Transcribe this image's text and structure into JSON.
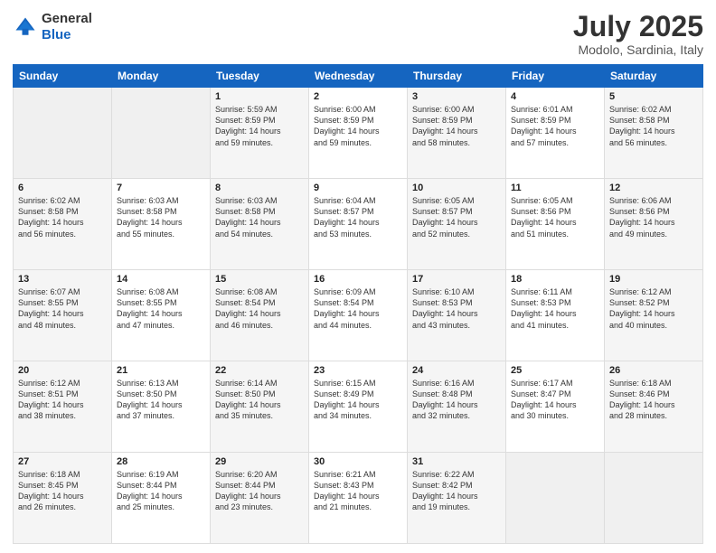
{
  "header": {
    "logo_general": "General",
    "logo_blue": "Blue",
    "title": "July 2025",
    "location": "Modolo, Sardinia, Italy"
  },
  "weekdays": [
    "Sunday",
    "Monday",
    "Tuesday",
    "Wednesday",
    "Thursday",
    "Friday",
    "Saturday"
  ],
  "weeks": [
    [
      {
        "day": "",
        "empty": true
      },
      {
        "day": "",
        "empty": true
      },
      {
        "day": "1",
        "sunrise": "5:59 AM",
        "sunset": "8:59 PM",
        "daylight": "14 hours and 59 minutes."
      },
      {
        "day": "2",
        "sunrise": "6:00 AM",
        "sunset": "8:59 PM",
        "daylight": "14 hours and 59 minutes."
      },
      {
        "day": "3",
        "sunrise": "6:00 AM",
        "sunset": "8:59 PM",
        "daylight": "14 hours and 58 minutes."
      },
      {
        "day": "4",
        "sunrise": "6:01 AM",
        "sunset": "8:59 PM",
        "daylight": "14 hours and 57 minutes."
      },
      {
        "day": "5",
        "sunrise": "6:02 AM",
        "sunset": "8:58 PM",
        "daylight": "14 hours and 56 minutes."
      }
    ],
    [
      {
        "day": "6",
        "sunrise": "6:02 AM",
        "sunset": "8:58 PM",
        "daylight": "14 hours and 56 minutes."
      },
      {
        "day": "7",
        "sunrise": "6:03 AM",
        "sunset": "8:58 PM",
        "daylight": "14 hours and 55 minutes."
      },
      {
        "day": "8",
        "sunrise": "6:03 AM",
        "sunset": "8:58 PM",
        "daylight": "14 hours and 54 minutes."
      },
      {
        "day": "9",
        "sunrise": "6:04 AM",
        "sunset": "8:57 PM",
        "daylight": "14 hours and 53 minutes."
      },
      {
        "day": "10",
        "sunrise": "6:05 AM",
        "sunset": "8:57 PM",
        "daylight": "14 hours and 52 minutes."
      },
      {
        "day": "11",
        "sunrise": "6:05 AM",
        "sunset": "8:56 PM",
        "daylight": "14 hours and 51 minutes."
      },
      {
        "day": "12",
        "sunrise": "6:06 AM",
        "sunset": "8:56 PM",
        "daylight": "14 hours and 49 minutes."
      }
    ],
    [
      {
        "day": "13",
        "sunrise": "6:07 AM",
        "sunset": "8:55 PM",
        "daylight": "14 hours and 48 minutes."
      },
      {
        "day": "14",
        "sunrise": "6:08 AM",
        "sunset": "8:55 PM",
        "daylight": "14 hours and 47 minutes."
      },
      {
        "day": "15",
        "sunrise": "6:08 AM",
        "sunset": "8:54 PM",
        "daylight": "14 hours and 46 minutes."
      },
      {
        "day": "16",
        "sunrise": "6:09 AM",
        "sunset": "8:54 PM",
        "daylight": "14 hours and 44 minutes."
      },
      {
        "day": "17",
        "sunrise": "6:10 AM",
        "sunset": "8:53 PM",
        "daylight": "14 hours and 43 minutes."
      },
      {
        "day": "18",
        "sunrise": "6:11 AM",
        "sunset": "8:53 PM",
        "daylight": "14 hours and 41 minutes."
      },
      {
        "day": "19",
        "sunrise": "6:12 AM",
        "sunset": "8:52 PM",
        "daylight": "14 hours and 40 minutes."
      }
    ],
    [
      {
        "day": "20",
        "sunrise": "6:12 AM",
        "sunset": "8:51 PM",
        "daylight": "14 hours and 38 minutes."
      },
      {
        "day": "21",
        "sunrise": "6:13 AM",
        "sunset": "8:50 PM",
        "daylight": "14 hours and 37 minutes."
      },
      {
        "day": "22",
        "sunrise": "6:14 AM",
        "sunset": "8:50 PM",
        "daylight": "14 hours and 35 minutes."
      },
      {
        "day": "23",
        "sunrise": "6:15 AM",
        "sunset": "8:49 PM",
        "daylight": "14 hours and 34 minutes."
      },
      {
        "day": "24",
        "sunrise": "6:16 AM",
        "sunset": "8:48 PM",
        "daylight": "14 hours and 32 minutes."
      },
      {
        "day": "25",
        "sunrise": "6:17 AM",
        "sunset": "8:47 PM",
        "daylight": "14 hours and 30 minutes."
      },
      {
        "day": "26",
        "sunrise": "6:18 AM",
        "sunset": "8:46 PM",
        "daylight": "14 hours and 28 minutes."
      }
    ],
    [
      {
        "day": "27",
        "sunrise": "6:18 AM",
        "sunset": "8:45 PM",
        "daylight": "14 hours and 26 minutes."
      },
      {
        "day": "28",
        "sunrise": "6:19 AM",
        "sunset": "8:44 PM",
        "daylight": "14 hours and 25 minutes."
      },
      {
        "day": "29",
        "sunrise": "6:20 AM",
        "sunset": "8:44 PM",
        "daylight": "14 hours and 23 minutes."
      },
      {
        "day": "30",
        "sunrise": "6:21 AM",
        "sunset": "8:43 PM",
        "daylight": "14 hours and 21 minutes."
      },
      {
        "day": "31",
        "sunrise": "6:22 AM",
        "sunset": "8:42 PM",
        "daylight": "14 hours and 19 minutes."
      },
      {
        "day": "",
        "empty": true
      },
      {
        "day": "",
        "empty": true
      }
    ]
  ],
  "labels": {
    "sunrise": "Sunrise:",
    "sunset": "Sunset:",
    "daylight": "Daylight:"
  }
}
